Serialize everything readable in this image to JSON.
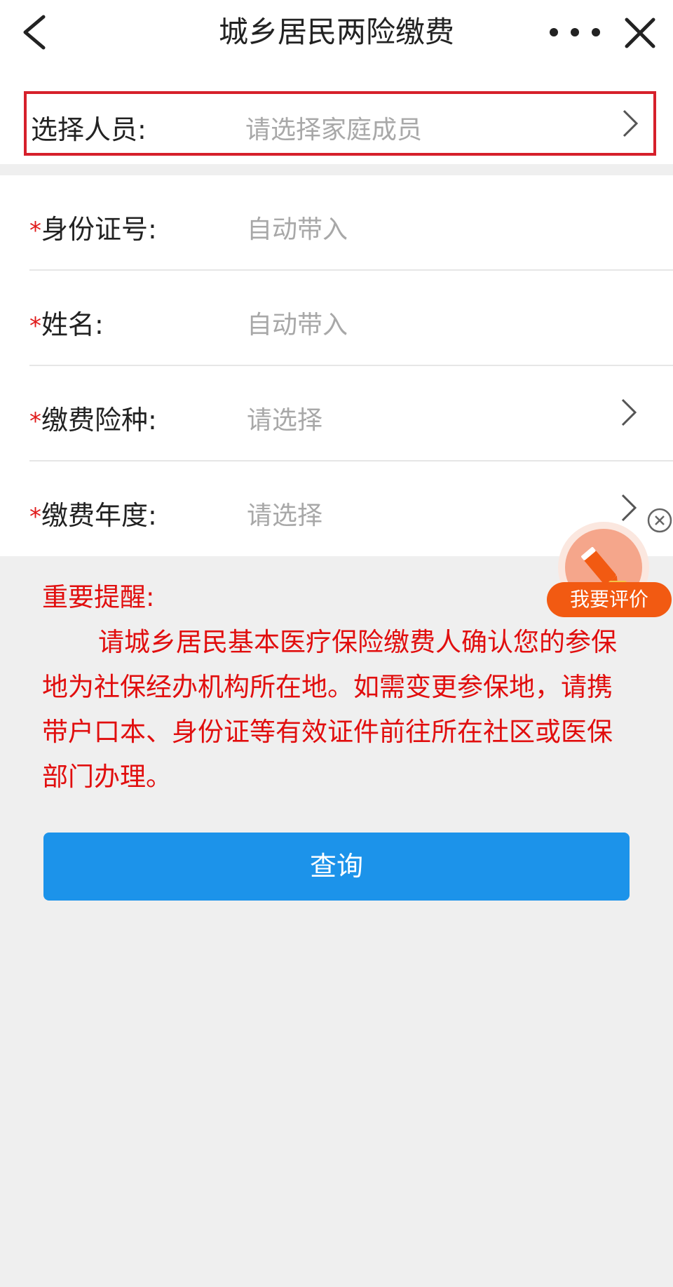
{
  "header": {
    "title": "城乡居民两险缴费"
  },
  "select_person": {
    "label": "选择人员:",
    "placeholder": "请选择家庭成员"
  },
  "form": {
    "required_mark": "*",
    "id_number": {
      "label": "身份证号:",
      "value": "自动带入"
    },
    "name": {
      "label": "姓名:",
      "value": "自动带入"
    },
    "insurance_type": {
      "label": "缴费险种:",
      "value": "请选择"
    },
    "payment_year": {
      "label": "缴费年度:",
      "value": "请选择"
    }
  },
  "notice": {
    "title": "重要提醒:",
    "body": "请城乡居民基本医疗保险缴费人确认您的参保地为社保经办机构所在地。如需变更参保地，请携带户口本、身份证等有效证件前往所在社区或医保部门办理。"
  },
  "query_button": {
    "label": "查询"
  },
  "evaluate_widget": {
    "label": "我要评价"
  },
  "colors": {
    "accent_blue": "#1c93ea",
    "notice_red": "#e10e0e",
    "highlight_border": "#d6202b",
    "widget_orange": "#f25a12"
  },
  "icons": [
    "back-arrow-icon",
    "more-dots-icon",
    "close-x-icon",
    "chevron-right-icon",
    "pencil-icon",
    "close-circle-icon"
  ]
}
